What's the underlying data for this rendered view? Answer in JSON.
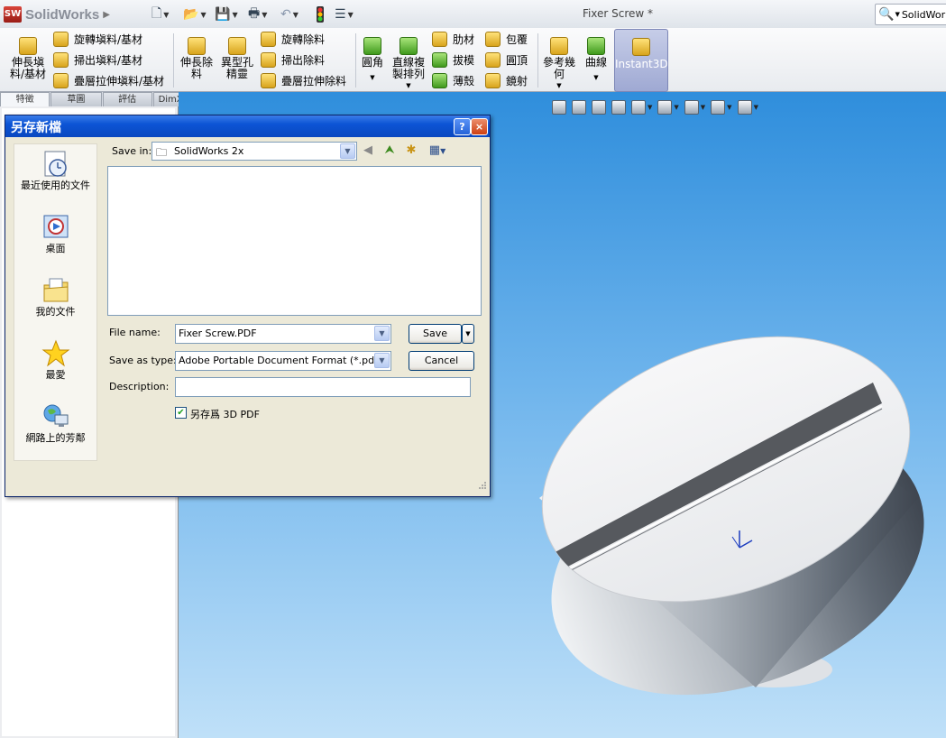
{
  "app": {
    "brand": "SolidWorks",
    "doc_title": "Fixer Screw *",
    "search_text": "SolidWork"
  },
  "commands": {
    "extrude_boss": "伸長塡料/基材",
    "revolve_boss": "旋轉塡料/基材",
    "sweep_boss": "掃出塡料/基材",
    "loft_boss": "疊層拉伸塡料/基材",
    "extrude_cut": "伸長除料",
    "hole_wizard": "異型孔精靈",
    "revolve_cut": "旋轉除料",
    "sweep_cut": "掃出除料",
    "loft_cut": "疊層拉伸除料",
    "fillet": "圓角",
    "linear_pattern": "直線複製排列",
    "rib": "肋材",
    "draft": "拔模",
    "shell": "薄殼",
    "wrap": "包覆",
    "dome": "圓頂",
    "mirror": "鏡射",
    "ref_geometry": "參考幾何",
    "curves": "曲線",
    "instant3d": "Instant3D"
  },
  "tabs": [
    "特徵",
    "草圖",
    "評估",
    "DimXpert"
  ],
  "dialog": {
    "title": "另存新檔",
    "help": "?",
    "close": "×",
    "places": [
      "最近使用的文件",
      "桌面",
      "我的文件",
      "最愛",
      "網路上的芳鄰"
    ],
    "save_in_label": "Save in:",
    "save_in_value": "SolidWorks 2x",
    "file_name_label": "File name:",
    "file_name_value": "Fixer Screw.PDF",
    "save_as_type_label": "Save as type:",
    "save_as_type_value": "Adobe Portable Document Format (*.pdf)",
    "description_label": "Description:",
    "description_value": "",
    "save_button": "Save",
    "cancel_button": "Cancel",
    "checkbox_label": "另存爲 3D PDF",
    "checkbox_checked": true
  },
  "colors": {
    "dialog_title": "#0c54d5",
    "viewport_top": "#2f8edc",
    "viewport_bottom": "#bfe0f8"
  }
}
